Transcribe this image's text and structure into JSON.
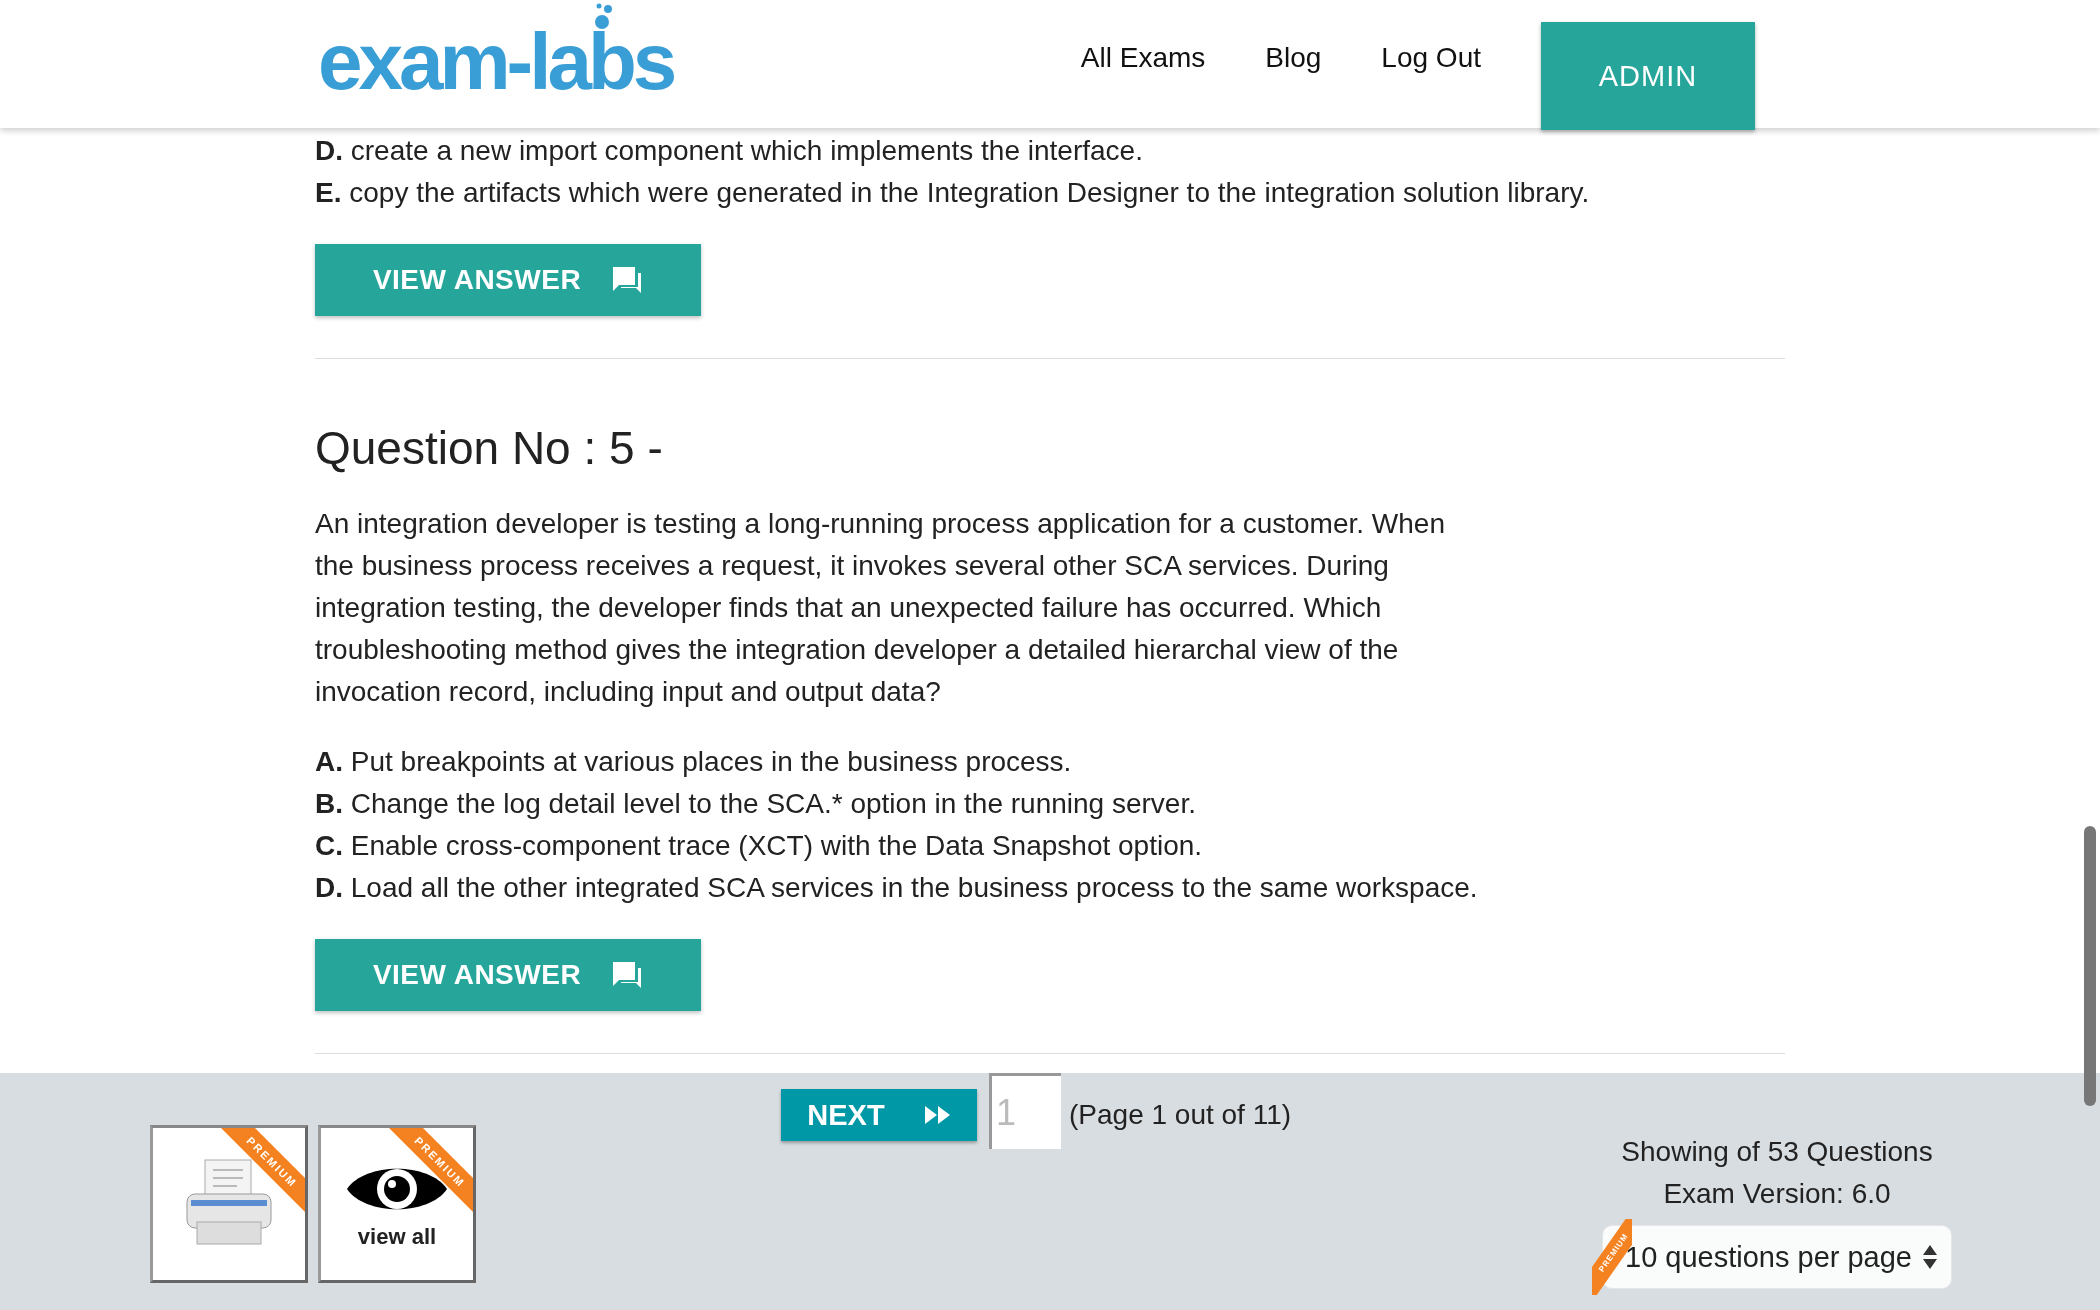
{
  "header": {
    "logo": "exam-labs",
    "nav": [
      {
        "label": "All Exams"
      },
      {
        "label": "Blog"
      },
      {
        "label": "Log Out"
      }
    ],
    "admin_button": "ADMIN"
  },
  "previous_question": {
    "options": [
      "**D.** create a new import component which implements the interface.",
      "**E.** copy the artifacts which were generated in the Integration Designer to the integration solution library."
    ],
    "view_answer": "VIEW ANSWER"
  },
  "question": {
    "title": "Question No : 5 -",
    "text": "An integration developer is testing a long-running process application for a customer. When the business process receives a request, it invokes several other SCA services. During integration testing, the developer finds that an unexpected failure has occurred. Which troubleshooting method gives the integration developer a detailed hierarchal view of the invocation record, including input and output data?",
    "options": [
      "**A.** Put breakpoints at various places in the business process.",
      "**B.** Change the log detail level to the SCA.* option in the running server.",
      "**C.** Enable cross-component trace (XCT) with the Data Snapshot option.",
      "**D.** Load all the other integrated SCA services in the business process to the same workspace."
    ],
    "view_answer": "VIEW ANSWER"
  },
  "footer": {
    "tiles": [
      {
        "kind": "print",
        "ribbon": "PREMIUM"
      },
      {
        "kind": "view",
        "ribbon": "PREMIUM",
        "label": "view all"
      }
    ],
    "next_button": "NEXT",
    "page_input": {
      "placeholder": "1"
    },
    "page_info": "(Page 1 out of 11)",
    "showing": "Showing of 53 Questions",
    "version": "Exam Version: 6.0",
    "per_page": {
      "ribbon": "PREMIUM",
      "value": "10 questions per page"
    }
  }
}
